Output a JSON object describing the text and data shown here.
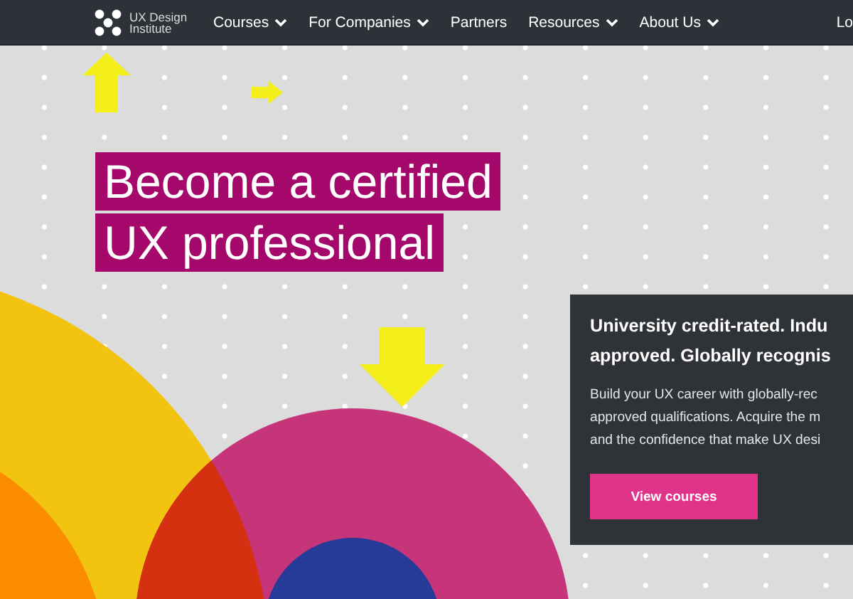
{
  "nav": {
    "logo": [
      "UX Design",
      "Institute"
    ],
    "items": [
      {
        "label": "Courses",
        "dropdown": true
      },
      {
        "label": "For Companies",
        "dropdown": true
      },
      {
        "label": "Partners",
        "dropdown": false
      },
      {
        "label": "Resources",
        "dropdown": true
      },
      {
        "label": "About Us",
        "dropdown": true
      }
    ],
    "login": "Lo"
  },
  "hero": {
    "headline": [
      "Become a certified",
      "UX professional"
    ],
    "card": {
      "title": [
        "University credit-rated. Indu",
        "approved. Globally recognis"
      ],
      "body": [
        "Build your UX career with globally-rec",
        "approved qualifications. Acquire the m",
        "and the confidence that make UX desi"
      ],
      "button": "View courses"
    }
  }
}
